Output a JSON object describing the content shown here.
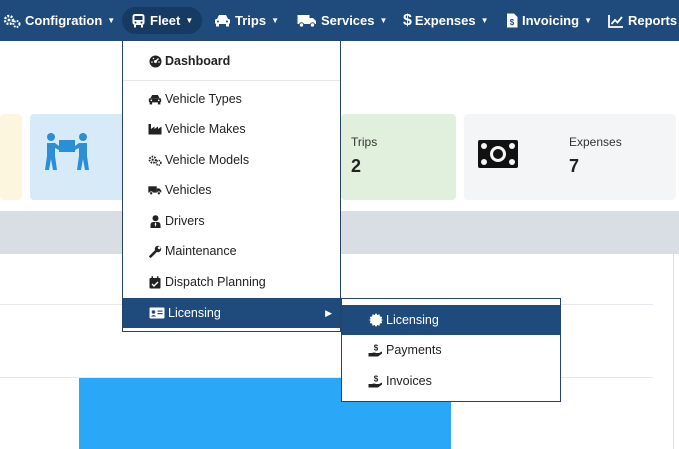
{
  "nav": {
    "items": [
      {
        "label": "Configration",
        "icon": "gears-icon"
      },
      {
        "label": "Fleet",
        "icon": "bus-icon"
      },
      {
        "label": "Trips",
        "icon": "car-icon"
      },
      {
        "label": "Services",
        "icon": "truck-icon"
      },
      {
        "label": "Expenses",
        "icon": "dollar-icon"
      },
      {
        "label": "Invoicing",
        "icon": "invoice-file-icon"
      },
      {
        "label": "Reports",
        "icon": "line-chart-icon"
      }
    ],
    "active": "Fleet",
    "colors": {
      "bar": "#1f4a7c",
      "active": "#173a63"
    }
  },
  "cards": [
    {
      "label": "Trips",
      "value": "2",
      "icon": "none",
      "color": "#e1f0dc"
    },
    {
      "label": "Expenses",
      "value": "7",
      "icon": "money-bill-icon",
      "color": "#f3f5f7"
    }
  ],
  "fleet_menu": {
    "header": "Dashboard",
    "items": [
      {
        "label": "Vehicle Types",
        "icon": "car-icon"
      },
      {
        "label": "Vehicle Makes",
        "icon": "industry-icon"
      },
      {
        "label": "Vehicle Models",
        "icon": "cogs-icon"
      },
      {
        "label": "Vehicles",
        "icon": "truck-icon"
      },
      {
        "label": "Drivers",
        "icon": "user-tie-icon"
      },
      {
        "label": "Maintenance",
        "icon": "wrench-icon"
      },
      {
        "label": "Dispatch Planning",
        "icon": "calendar-check-icon"
      },
      {
        "label": "Licensing",
        "icon": "id-card-icon"
      }
    ],
    "active": "Licensing"
  },
  "licensing_menu": {
    "items": [
      {
        "label": "Licensing",
        "icon": "certificate-icon"
      },
      {
        "label": "Payments",
        "icon": "hand-holding-usd-icon"
      },
      {
        "label": "Invoices",
        "icon": "hand-holding-usd-icon"
      }
    ],
    "active": "Licensing"
  }
}
